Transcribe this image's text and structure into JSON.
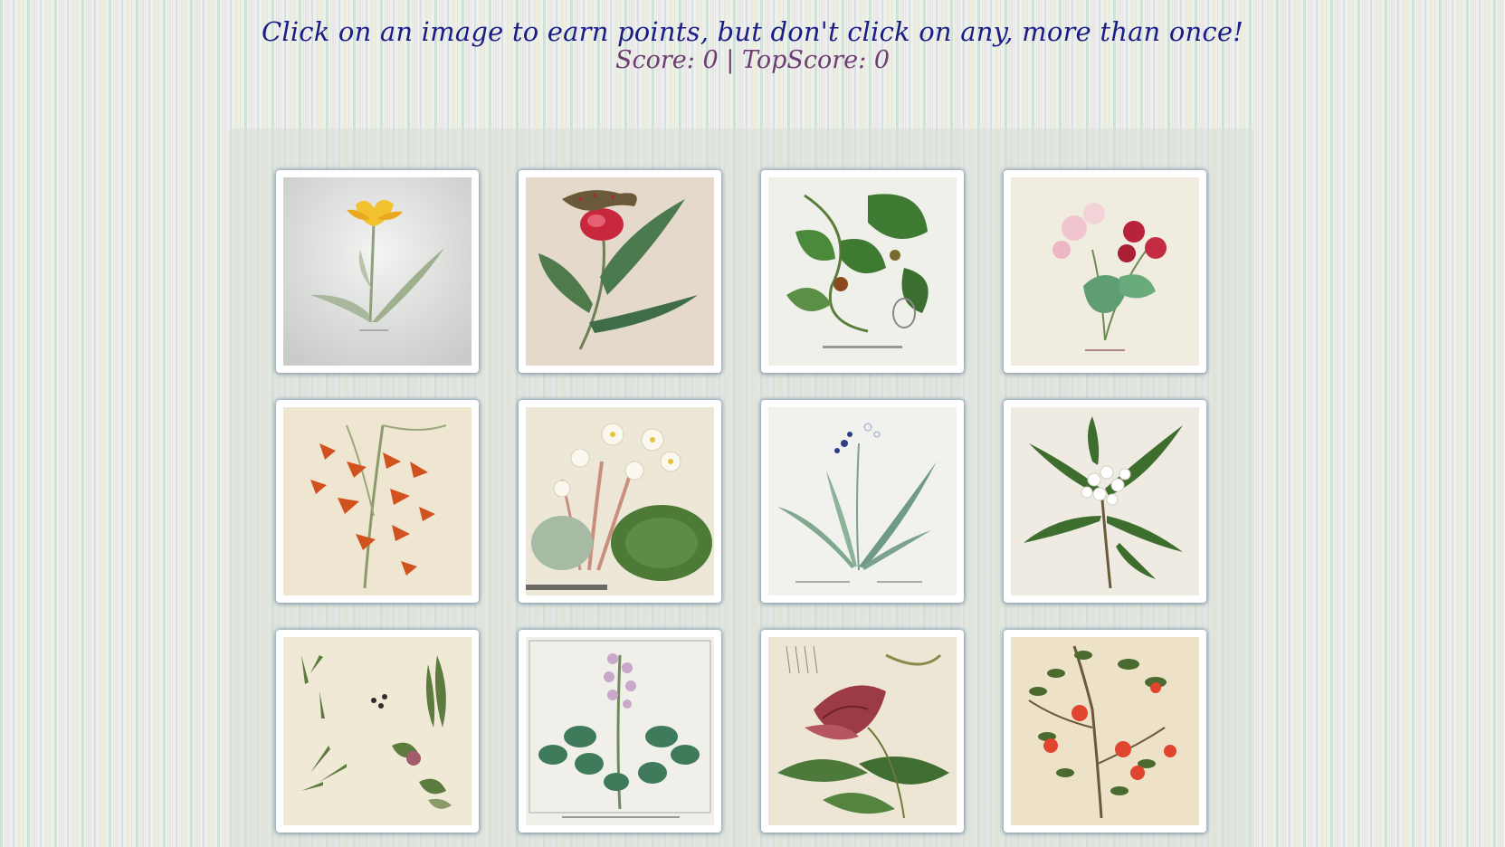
{
  "header": {
    "instructions": "Click on an image to earn points, but don't click on any, more than once!",
    "score_label": "Score:",
    "score": "0",
    "separator": "|",
    "top_score_label": "TopScore:",
    "top_score": "0"
  },
  "cards": [
    {
      "icon": "yellow-tulip-illustration",
      "bg": "#dcdedb"
    },
    {
      "icon": "red-lady-slipper-orchid-illustration",
      "bg": "#e4d9cb"
    },
    {
      "icon": "green-vine-aristolochia-illustration",
      "bg": "#eff0ea"
    },
    {
      "icon": "pink-red-geranium-illustration",
      "bg": "#f1ece0"
    },
    {
      "icon": "orange-orchid-spray-illustration",
      "bg": "#efe6d2"
    },
    {
      "icon": "white-begonia-illustration",
      "bg": "#ede7d8"
    },
    {
      "icon": "blue-spiderwort-illustration",
      "bg": "#f1f1ee"
    },
    {
      "icon": "white-flowering-shrub-illustration",
      "bg": "#efebe2"
    },
    {
      "icon": "assorted-leaves-illustration",
      "bg": "#efe9d6"
    },
    {
      "icon": "pink-dictamnus-illustration",
      "bg": "#f1efea"
    },
    {
      "icon": "red-trumpet-vine-illustration",
      "bg": "#eee6d4"
    },
    {
      "icon": "pomegranate-shrub-illustration",
      "bg": "#ede2c8"
    }
  ],
  "colors": {
    "instructions": "#1a1d86",
    "score": "#6f3d73"
  }
}
